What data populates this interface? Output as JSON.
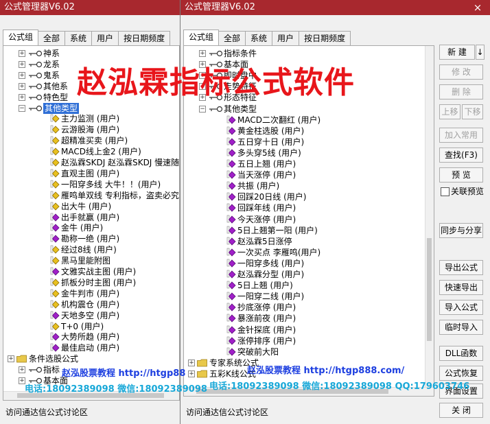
{
  "left_window": {
    "title": "公式管理器V6.02",
    "close": "×",
    "tabs": [
      "公式组",
      "全部",
      "系统",
      "用户",
      "按日期频度"
    ],
    "tree": [
      {
        "label": "神系",
        "kind": "key"
      },
      {
        "label": "龙系",
        "kind": "key"
      },
      {
        "label": "鬼系",
        "kind": "key"
      },
      {
        "label": "其他系",
        "kind": "key"
      },
      {
        "label": "特色型",
        "kind": "key"
      },
      {
        "label": "其他类型",
        "kind": "key",
        "expanded": true,
        "selected": true
      },
      {
        "label": "主力监测   (用户)",
        "kind": "yellow"
      },
      {
        "label": "云游股海   (用户)",
        "kind": "yellow"
      },
      {
        "label": "超精准买卖   (用户)",
        "kind": "yellow"
      },
      {
        "label": "MACD线上金2   (用户)",
        "kind": "yellow"
      },
      {
        "label": "赵泓霖SKDJ  赵泓霖SKDJ 慢速随机",
        "kind": "yellow"
      },
      {
        "label": "直观主图   (用户)",
        "kind": "yellow"
      },
      {
        "label": "一阳穿多线   大牛！！(用户)",
        "kind": "yellow"
      },
      {
        "label": "雁鸣单双线   专利指标，盗卖必究",
        "kind": "yellow"
      },
      {
        "label": "出大牛   (用户)",
        "kind": "yellow"
      },
      {
        "label": "出手就赢   (用户)",
        "kind": "purple"
      },
      {
        "label": "金牛   (用户)",
        "kind": "purple"
      },
      {
        "label": "勘称一绝   (用户)",
        "kind": "purple"
      },
      {
        "label": "经过8线   (用户)",
        "kind": "yellow"
      },
      {
        "label": "黑马里能附图",
        "kind": "yellow"
      },
      {
        "label": "文雅实战主图   (用户)",
        "kind": "purple"
      },
      {
        "label": "抓板分时主图   (用户)",
        "kind": "yellow"
      },
      {
        "label": "金牛判市   (用户)",
        "kind": "yellow"
      },
      {
        "label": "机构震仓   (用户)",
        "kind": "yellow"
      },
      {
        "label": "天地多空   (用户)",
        "kind": "purple"
      },
      {
        "label": "T+0   (用户)",
        "kind": "yellow"
      },
      {
        "label": "大势所趋   (用户)",
        "kind": "purple"
      },
      {
        "label": "最佳启动   (用户)",
        "kind": "purple"
      },
      {
        "label": "条件选股公式",
        "kind": "folder",
        "root": true
      },
      {
        "label": "指标",
        "kind": "key"
      },
      {
        "label": "基本面",
        "kind": "key"
      }
    ],
    "status": "访问通达信公式讨论区"
  },
  "right_window": {
    "title": "公式管理器V6.02",
    "close": "×",
    "tabs": [
      "公式组",
      "全部",
      "系统",
      "用户",
      "按日期频度"
    ],
    "tree": [
      {
        "label": "指标条件",
        "kind": "key"
      },
      {
        "label": "基本面",
        "kind": "key"
      },
      {
        "label": "即时盘中",
        "kind": "key"
      },
      {
        "label": "走势特征",
        "kind": "key"
      },
      {
        "label": "形态特征",
        "kind": "key"
      },
      {
        "label": "其他类型",
        "kind": "key",
        "expanded": true
      },
      {
        "label": "MACD二次翻红   (用户)",
        "kind": "purple"
      },
      {
        "label": "黄金柱选股   (用户)",
        "kind": "purple"
      },
      {
        "label": "五日穿十日   (用户)",
        "kind": "purple"
      },
      {
        "label": "多头穿5线   (用户)",
        "kind": "purple"
      },
      {
        "label": "五日上翘   (用户)",
        "kind": "purple"
      },
      {
        "label": "当天涨停   (用户)",
        "kind": "purple"
      },
      {
        "label": "共振   (用户)",
        "kind": "purple"
      },
      {
        "label": "回踩20日线   (用户)",
        "kind": "purple"
      },
      {
        "label": "回踩年线   (用户)",
        "kind": "purple"
      },
      {
        "label": "今天涨停   (用户)",
        "kind": "purple"
      },
      {
        "label": "5日上翘第一阳   (用户)",
        "kind": "purple"
      },
      {
        "label": "赵泓霖5日涨停",
        "kind": "purple"
      },
      {
        "label": "一次买点   李雁鸣(用户)",
        "kind": "purple"
      },
      {
        "label": "一阳穿多线   (用户)",
        "kind": "purple"
      },
      {
        "label": "赵泓霖分型   (用户)",
        "kind": "purple"
      },
      {
        "label": "5日上翘   (用户)",
        "kind": "purple"
      },
      {
        "label": "一阳穿二线   (用户)",
        "kind": "purple"
      },
      {
        "label": "抄底涨停   (用户)",
        "kind": "purple"
      },
      {
        "label": "暴涨前夜   (用户)",
        "kind": "purple"
      },
      {
        "label": "金针探底   (用户)",
        "kind": "purple"
      },
      {
        "label": "涨停排序   (用户)",
        "kind": "purple"
      },
      {
        "label": "突破前大阳",
        "kind": "purple"
      },
      {
        "label": "专家系统公式",
        "kind": "folder",
        "root": true
      },
      {
        "label": "五彩K线公式",
        "kind": "folder",
        "root": true
      }
    ],
    "status": "访问通达信公式讨论区",
    "buttons": {
      "new": "新 建",
      "new_arrow": "↓",
      "modify": "修 改",
      "delete": "删 除",
      "move_up": "上移",
      "move_down": "下移",
      "add_common": "加入常用",
      "find": "查找(F3)",
      "preview": "预 览",
      "link_preview": "关联预览",
      "sync_share": "同步与分享",
      "export": "导出公式",
      "quick_export": "快速导出",
      "import": "导入公式",
      "temp_import": "临时导入",
      "dll": "DLL函数",
      "restore": "公式恢复",
      "ui_settings": "界面设置",
      "close": "关 闭"
    }
  },
  "overlay": {
    "title": "赵泓霖指标公式软件",
    "wm_left_1": "赵泓股票教程 http://htgp88",
    "wm_left_2": "电话:18092389098 微信:18092389098",
    "wm_right_1": "赵泓股票教程 http://htgp888.com/",
    "wm_right_2": "电话:18092389098 微信:18092389098 QQ:179603746"
  },
  "colors": {
    "titlebar": "#a8282e",
    "selection": "#2f6fd6",
    "overlay_red": "#e8161b",
    "watermark_blue": "#1d3fe0",
    "watermark_cyan": "#18a8d8"
  }
}
